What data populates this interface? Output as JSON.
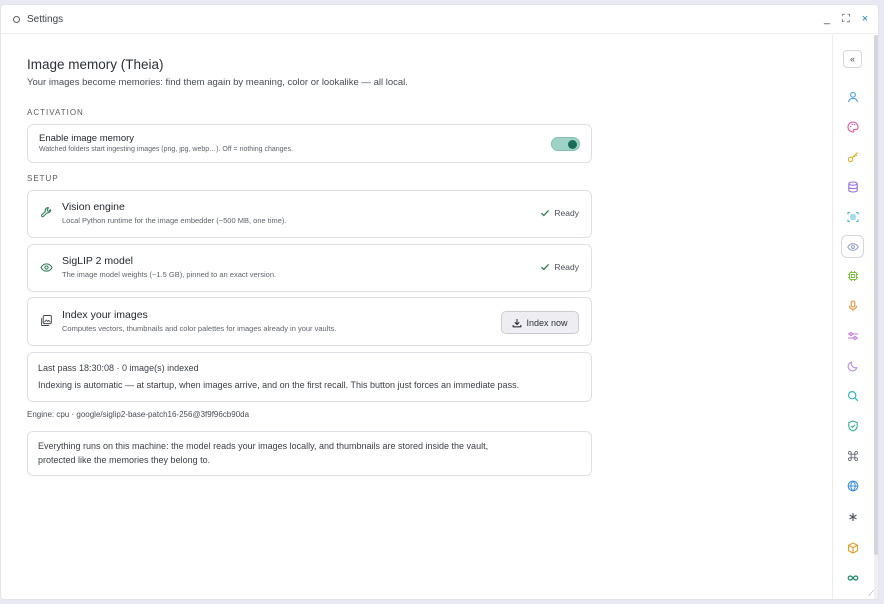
{
  "window": {
    "title": "Settings",
    "controls": {
      "minimize": "_",
      "maximize": "⛶",
      "close": "×"
    }
  },
  "page": {
    "title": "Image memory (Theia)",
    "subtitle": "Your images become memories: find them again by meaning, color or lookalike — all local."
  },
  "activation": {
    "section_label": "ACTIVATION",
    "title": "Enable image memory",
    "description": "Watched folders start ingesting images (png, jpg, webp…). Off = nothing changes.",
    "enabled": true
  },
  "setup": {
    "section_label": "SETUP",
    "vision_engine": {
      "title": "Vision engine",
      "description": "Local Python runtime for the image embedder (~500 MB, one time).",
      "status": "Ready"
    },
    "model": {
      "title": "SigLIP 2 model",
      "description": "The image model weights (~1.5 GB), pinned to an exact version.",
      "status": "Ready"
    },
    "index": {
      "title": "Index your images",
      "description": "Computes vectors, thumbnails and color palettes for images already in your vaults.",
      "button": "Index now"
    }
  },
  "last_pass": {
    "line1": "Last pass 18:30:08 · 0 image(s) indexed",
    "line2": "Indexing is automatic — at startup, when images arrive, and on the first recall. This button just forces an immediate pass."
  },
  "engine_line": "Engine: cpu · google/siglip2-base-patch16-256@3f9f96cb90da",
  "privacy": {
    "line1": "Everything runs on this machine: the model reads your images locally, and thumbnails are stored inside the vault,",
    "line2": "protected like the memories they belong to."
  },
  "sidebar": {
    "collapse": "«",
    "colors": {
      "user": "#4aa3df",
      "palette": "#e0559b",
      "key": "#e0b020",
      "database": "#9a6fd6",
      "scan": "#45b7d6",
      "eye": "#9aa4c7",
      "chip": "#79c23a",
      "mic": "#ef8b2c",
      "sliders": "#c46fd6",
      "moon": "#b48ee0",
      "search": "#2fb3c9",
      "shield": "#31b28c",
      "command": "#6b7280",
      "globe": "#3b8fd6",
      "asterisk": "#545a63",
      "box": "#e49b25",
      "infinity": "#1f8a6a"
    }
  },
  "colors": {
    "accent": "#1f6b5b",
    "ready": "#2f7a57"
  }
}
